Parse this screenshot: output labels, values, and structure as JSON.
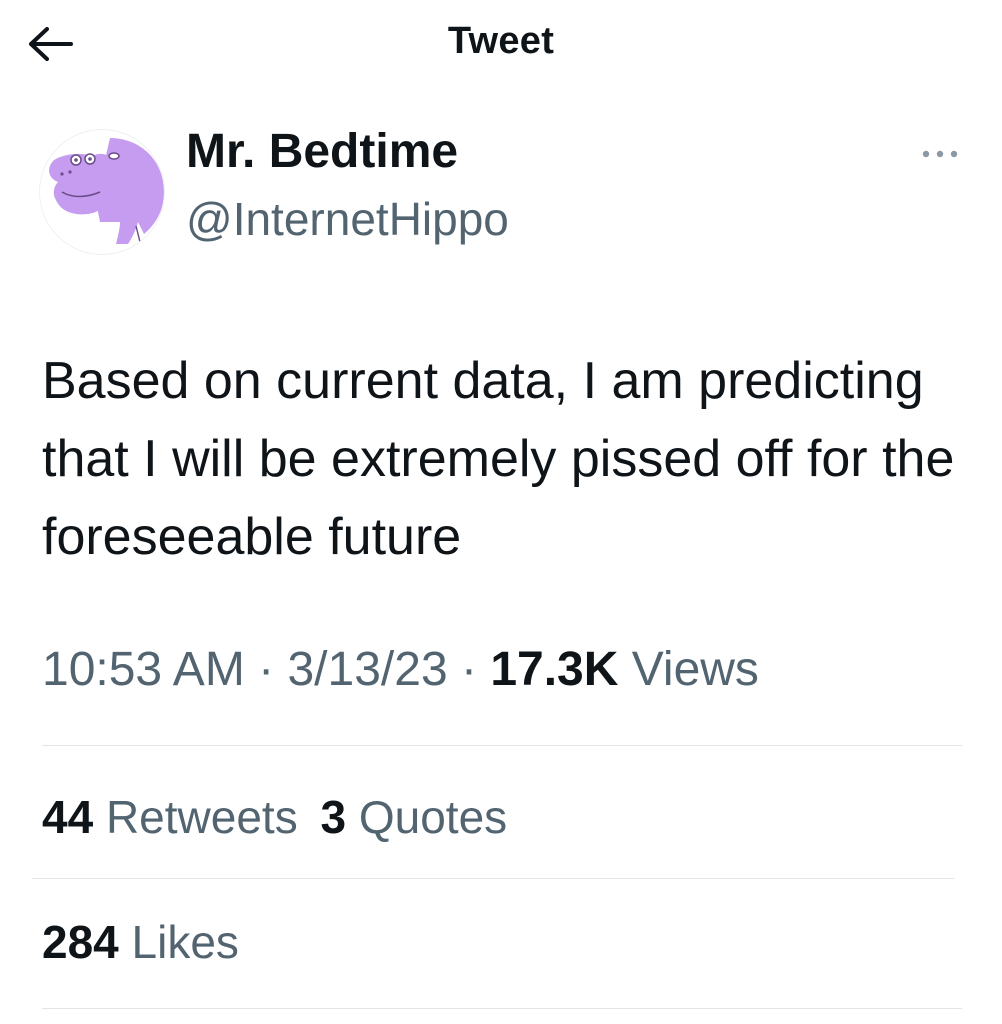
{
  "header": {
    "title": "Tweet",
    "back_icon": "arrow-left-icon"
  },
  "author": {
    "display_name": "Mr. Bedtime",
    "handle": "@InternetHippo",
    "avatar_icon": "purple-hippo-avatar",
    "avatar_color": "#c69cf0"
  },
  "more_icon": "ellipsis-icon",
  "tweet": {
    "text": "Based on current data, I am predicting that I will be extremely pissed off for the foreseeable future",
    "time": "10:53 AM",
    "separator": "·",
    "date": "3/13/23",
    "views_count": "17.3K",
    "views_label": "Views"
  },
  "stats": {
    "retweets_count": "44",
    "retweets_label": "Retweets",
    "quotes_count": "3",
    "quotes_label": "Quotes",
    "likes_count": "284",
    "likes_label": "Likes"
  },
  "colors": {
    "text_primary": "#0f1419",
    "text_secondary": "#536471",
    "divider": "#e1e5e8"
  }
}
